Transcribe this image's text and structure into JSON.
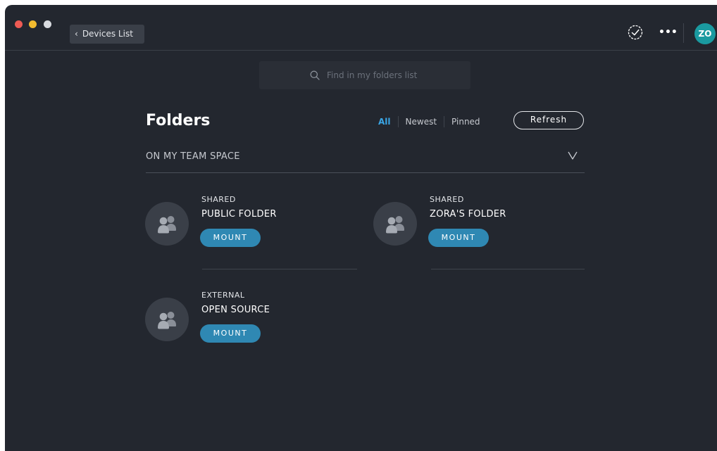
{
  "titlebar": {
    "back_label": "Devices List",
    "avatar_initials": "ZO",
    "more_label": "•••"
  },
  "search": {
    "placeholder": "Find in my folders list",
    "value": ""
  },
  "page": {
    "title": "Folders",
    "filters": [
      {
        "label": "All",
        "active": true
      },
      {
        "label": "Newest",
        "active": false
      },
      {
        "label": "Pinned",
        "active": false
      }
    ],
    "refresh_label": "Refresh"
  },
  "section": {
    "label": "ON MY TEAM SPACE"
  },
  "folders": [
    {
      "type": "SHARED",
      "name": "PUBLIC FOLDER",
      "action": "MOUNT"
    },
    {
      "type": "SHARED",
      "name": "ZORA'S FOLDER",
      "action": "MOUNT"
    },
    {
      "type": "EXTERNAL",
      "name": "OPEN SOURCE",
      "action": "MOUNT"
    }
  ],
  "colors": {
    "window_bg": "#23272f",
    "accent": "#3aa6e6",
    "mount_button": "#2f88b3",
    "avatar_bg": "#1a9aa0"
  },
  "icons": {
    "back": "chevron-left-icon",
    "sync": "check-circle-icon",
    "more": "more-horizontal-icon",
    "search": "search-icon",
    "section_toggle": "chevron-down-icon",
    "folder": "users-icon"
  }
}
